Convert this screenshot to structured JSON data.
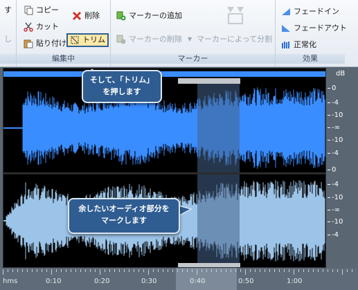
{
  "ribbon": {
    "edit_group_label": "編集中",
    "marker_group_label": "マーカー",
    "effects_group_label": "効果",
    "left_partial_top": "す",
    "left_partial_mid": "し",
    "left_group_label_partial": "",
    "copy_label": "コピー",
    "cut_label": "カット",
    "paste_label": "貼り付け",
    "delete_label": "削除",
    "trim_label": "トリム",
    "add_marker_label": "マーカーの追加",
    "delete_marker_label": "マーカーの削除",
    "split_by_marker_label": "マーカーによって分割",
    "fade_in_label": "フェードイン",
    "fade_out_label": "フェードアウト",
    "normalize_label": "正常化"
  },
  "db_scale": {
    "unit": "dB",
    "labels": [
      "0",
      "-4",
      "-10",
      "-∞",
      "-10",
      "-4",
      "0",
      "-4",
      "-10",
      "-∞",
      "-10",
      "-4"
    ]
  },
  "timeline": {
    "labels": [
      "hms",
      "0:10",
      "0:20",
      "0:30",
      "0:40",
      "0:50",
      "1:00"
    ]
  },
  "callouts": {
    "trim_line1": "そして、「トリム」",
    "trim_line2": "を押します",
    "audio_line1": "余したいオーディオ部分を",
    "audio_line2": "マークします"
  },
  "colors": {
    "top_wave": "#3a8dff",
    "bottom_wave": "#9cc4e8",
    "callout": "#2f5d92",
    "highlight_border": "#2d5f97"
  }
}
